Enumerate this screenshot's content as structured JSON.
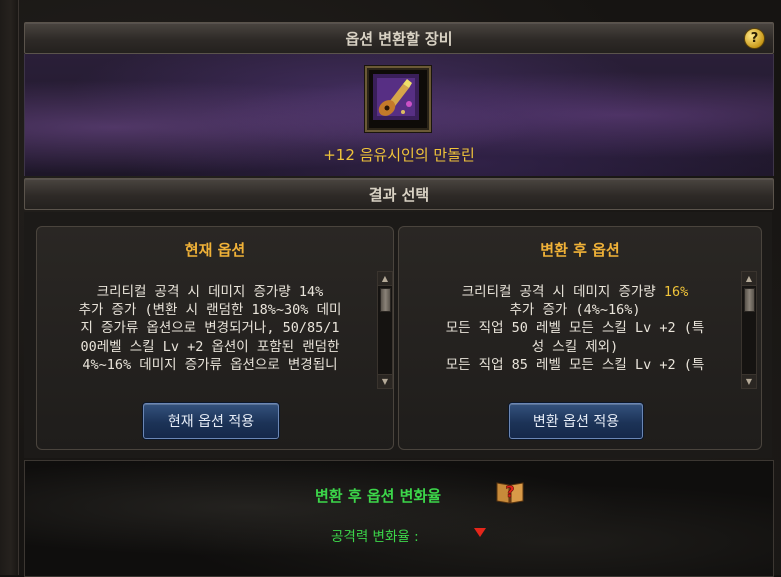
{
  "header": {
    "title": "옵션 변환할 장비",
    "help_label": "?"
  },
  "item": {
    "name": "+12 음유시인의 만돌린",
    "icon": "mandolin-icon"
  },
  "result": {
    "title": "결과 선택"
  },
  "current_option": {
    "title": "현재 옵션",
    "lines": [
      "크리티컬 공격 시 데미지 증가량 14%",
      "추가 증가 (변환 시 랜덤한 18%~30% 데미",
      "지 증가류 옵션으로 변경되거나, 50/85/1",
      "00레벨 스킬 Lv +2 옵션이 포함된 랜덤한",
      "4%~16% 데미지 증가류 옵션으로 변경됩니"
    ],
    "apply_label": "현재 옵션 적용"
  },
  "new_option": {
    "title": "변환 후 옵션",
    "line1_prefix": "크리티컬 공격 시 데미지 증가량 ",
    "line1_value": "16%",
    "lines": [
      "추가 증가 (4%~16%)",
      "모든 직업 50 레벨 모든 스킬 Lv +2 (특",
      "성 스킬 제외)",
      "모든 직업 85 레벨 모든 스킬 Lv +2 (특"
    ],
    "apply_label": "변환 옵션 적용"
  },
  "change_rate": {
    "title": "변환 후 옵션 변화율",
    "attack_label": "공격력 변화율 :",
    "attack_direction": "down",
    "arrow_color": "#e5261a"
  },
  "colors": {
    "accent_gold": "#f0b238",
    "item_name": "#f0c43a",
    "green_text": "#3cd64a",
    "button_blue": "#1c3357"
  }
}
